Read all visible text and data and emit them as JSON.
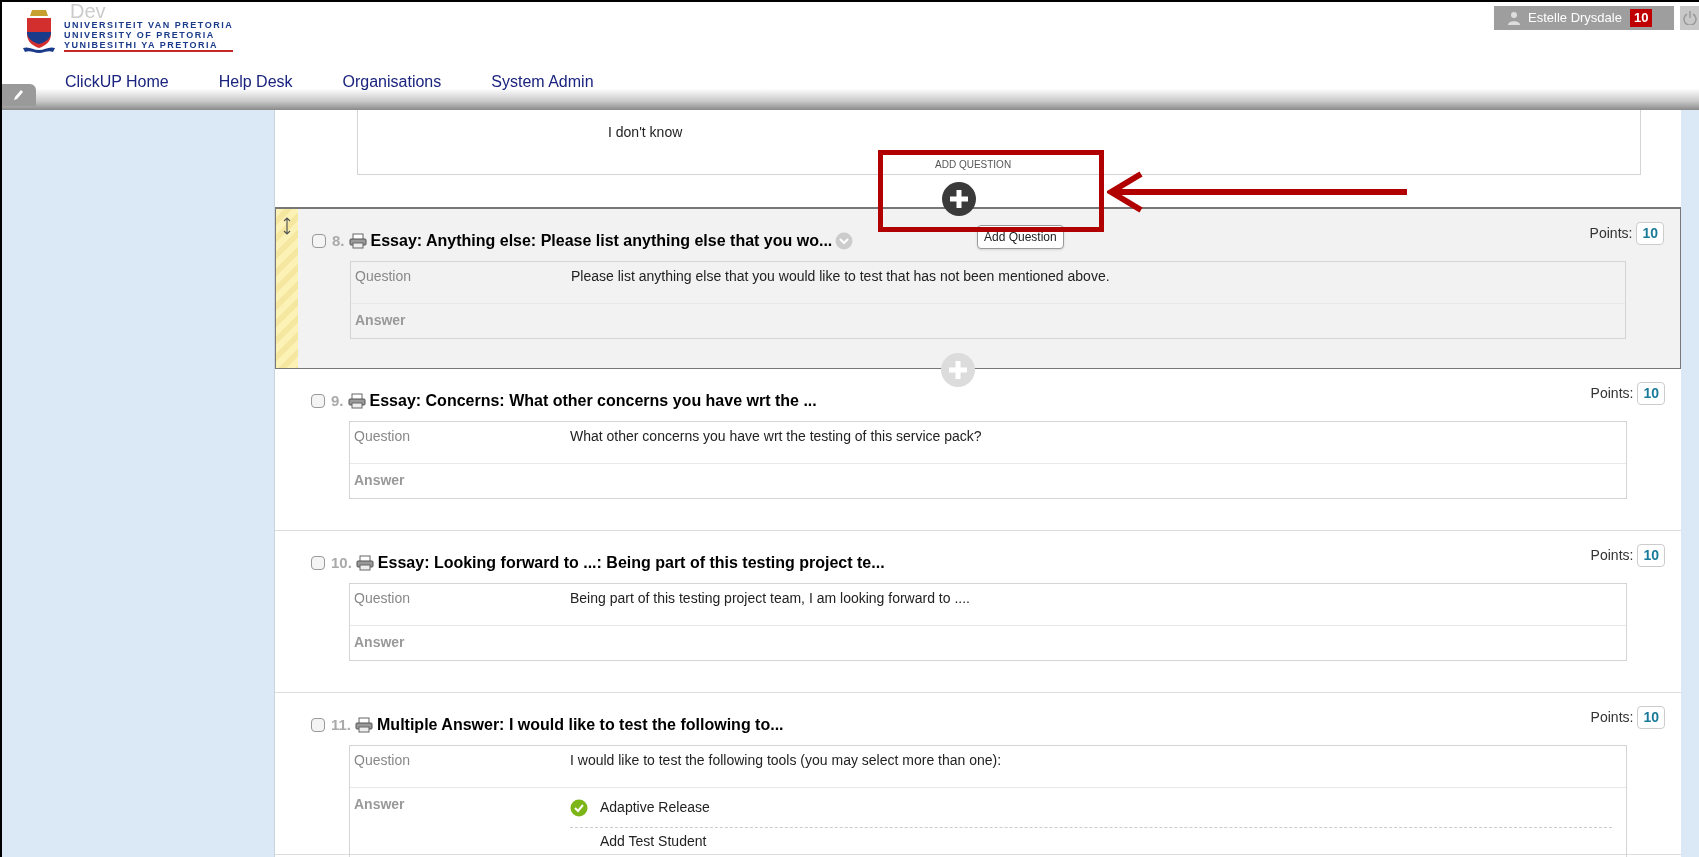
{
  "header": {
    "environment": "Dev",
    "logo_lines": [
      "UNIVERSITEIT VAN PRETORIA",
      "UNIVERSITY OF PRETORIA",
      "YUNIBESITHI YA PRETORIA"
    ],
    "nav": [
      {
        "label": "ClickUP Home"
      },
      {
        "label": "Help Desk"
      },
      {
        "label": "Organisations"
      },
      {
        "label": "System Admin"
      }
    ],
    "user": {
      "name": "Estelle Drysdale",
      "badge": "10"
    }
  },
  "previous_answer": "I don't know",
  "add_question": {
    "label": "ADD QUESTION",
    "tooltip": "Add Question"
  },
  "questions": [
    {
      "number": "8.",
      "title": "Essay: Anything else: Please list anything else that you wo...",
      "selected": true,
      "checked": false,
      "points_label": "Points:",
      "points": "10",
      "question_label": "Question",
      "question_text": "Please list anything else that you would like to test that has not been mentioned above.",
      "answer_label": "Answer"
    },
    {
      "number": "9.",
      "title": "Essay: Concerns: What other concerns you have wrt the ...",
      "selected": false,
      "checked": false,
      "points_label": "Points:",
      "points": "10",
      "question_label": "Question",
      "question_text": "What other concerns you have wrt the testing of this service pack?",
      "answer_label": "Answer"
    },
    {
      "number": "10.",
      "title": "Essay: Looking forward to ...: Being part of this testing project te...",
      "selected": false,
      "checked": false,
      "points_label": "Points:",
      "points": "10",
      "question_label": "Question",
      "question_text": "Being part of this testing project team, I am looking forward to ....",
      "answer_label": "Answer"
    },
    {
      "number": "11.",
      "title": "Multiple Answer: I would like to test the following to...",
      "selected": false,
      "checked": false,
      "points_label": "Points:",
      "points": "10",
      "question_label": "Question",
      "question_text": "I would like to test the following tools (you may select more than one):",
      "answer_label": "Answer",
      "answers": [
        {
          "text": "Adaptive Release",
          "correct": true
        },
        {
          "text": "Add Test Student",
          "correct": false
        }
      ]
    }
  ]
}
